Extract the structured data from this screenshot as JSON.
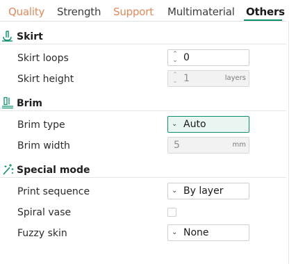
{
  "tabs": {
    "quality": "Quality",
    "strength": "Strength",
    "support": "Support",
    "multimaterial": "Multimaterial",
    "others": "Others"
  },
  "colors": {
    "accent": "#0a8f6e",
    "tab_inactive_orange": "#e08a5a"
  },
  "sections": {
    "skirt": {
      "title": "Skirt",
      "icon": "skirt-icon",
      "loops_label": "Skirt loops",
      "loops_value": "0",
      "height_label": "Skirt height",
      "height_value": "1",
      "height_unit": "layers"
    },
    "brim": {
      "title": "Brim",
      "icon": "brim-icon",
      "type_label": "Brim type",
      "type_value": "Auto",
      "width_label": "Brim width",
      "width_value": "5",
      "width_unit": "mm"
    },
    "special": {
      "title": "Special mode",
      "icon": "special-mode-icon",
      "sequence_label": "Print sequence",
      "sequence_value": "By layer",
      "spiral_label": "Spiral vase",
      "spiral_checked": false,
      "fuzzy_label": "Fuzzy skin",
      "fuzzy_value": "None"
    }
  }
}
